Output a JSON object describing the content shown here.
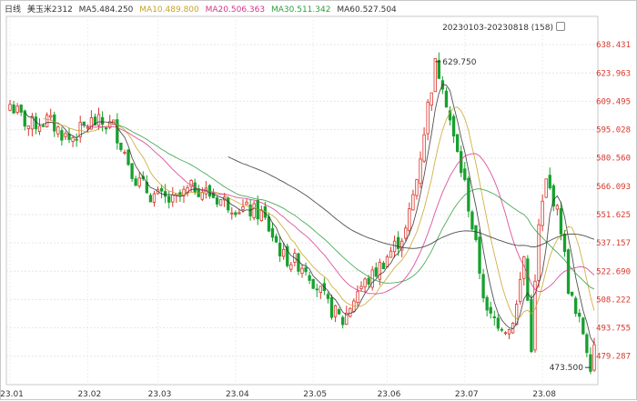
{
  "header": {
    "period": "日线",
    "symbol": "美玉米2312",
    "ma": [
      {
        "label": "MA5.",
        "value": "484.250",
        "color": "#333333"
      },
      {
        "label": "MA10.",
        "value": "489.800",
        "color": "#c9a227"
      },
      {
        "label": "MA20.",
        "value": "506.363",
        "color": "#d6338a"
      },
      {
        "label": "MA30.",
        "value": "511.342",
        "color": "#2e9e3e"
      },
      {
        "label": "MA60.",
        "value": "527.504",
        "color": "#333333"
      }
    ],
    "range": "20230103-20230818 (158)"
  },
  "colors": {
    "up": "#d9362b",
    "down": "#18a02e",
    "grid": "#c8c8c8",
    "axis_text": "#d9362b"
  },
  "icons": {
    "range": "settings-icon"
  },
  "chart_data": {
    "type": "candlestick",
    "title": "美玉米2312",
    "grid": true,
    "ylim": [
      464.74,
      652.9
    ],
    "y_ticks": [
      "638.431",
      "623.963",
      "609.495",
      "595.028",
      "580.560",
      "566.093",
      "551.625",
      "537.157",
      "522.690",
      "508.222",
      "493.755",
      "479.287"
    ],
    "x_ticks": [
      "23.01",
      "23.02",
      "23.03",
      "23.04",
      "23.05",
      "23.06",
      "23.07",
      "23.08"
    ],
    "annotations": {
      "high": "629.750",
      "low": "473.500"
    },
    "anchors": [
      {
        "d": 0,
        "p": 608
      },
      {
        "d": 5,
        "p": 597
      },
      {
        "d": 10,
        "p": 600
      },
      {
        "d": 16,
        "p": 590
      },
      {
        "d": 22,
        "p": 599
      },
      {
        "d": 28,
        "p": 597
      },
      {
        "d": 34,
        "p": 570
      },
      {
        "d": 38,
        "p": 562
      },
      {
        "d": 44,
        "p": 558
      },
      {
        "d": 50,
        "p": 566
      },
      {
        "d": 56,
        "p": 560
      },
      {
        "d": 62,
        "p": 555
      },
      {
        "d": 68,
        "p": 552
      },
      {
        "d": 74,
        "p": 530
      },
      {
        "d": 80,
        "p": 525
      },
      {
        "d": 86,
        "p": 505
      },
      {
        "d": 90,
        "p": 497
      },
      {
        "d": 94,
        "p": 513
      },
      {
        "d": 98,
        "p": 520
      },
      {
        "d": 103,
        "p": 533
      },
      {
        "d": 107,
        "p": 543
      },
      {
        "d": 110,
        "p": 570
      },
      {
        "d": 113,
        "p": 607
      },
      {
        "d": 115,
        "p": 628
      },
      {
        "d": 117,
        "p": 620
      },
      {
        "d": 120,
        "p": 590
      },
      {
        "d": 123,
        "p": 567
      },
      {
        "d": 126,
        "p": 535
      },
      {
        "d": 129,
        "p": 500
      },
      {
        "d": 132,
        "p": 497
      },
      {
        "d": 135,
        "p": 493
      },
      {
        "d": 137,
        "p": 505
      },
      {
        "d": 139,
        "p": 530
      },
      {
        "d": 141,
        "p": 485
      },
      {
        "d": 143,
        "p": 545
      },
      {
        "d": 145,
        "p": 568
      },
      {
        "d": 147,
        "p": 560
      },
      {
        "d": 149,
        "p": 545
      },
      {
        "d": 151,
        "p": 515
      },
      {
        "d": 153,
        "p": 500
      },
      {
        "d": 155,
        "p": 492
      },
      {
        "d": 157,
        "p": 476
      },
      {
        "d": 158,
        "p": 486
      }
    ],
    "ma_overlays": [
      {
        "name": "MA5",
        "period": 5,
        "color": "#333333"
      },
      {
        "name": "MA10",
        "period": 10,
        "color": "#c9a227"
      },
      {
        "name": "MA20",
        "period": 20,
        "color": "#d6338a"
      },
      {
        "name": "MA30",
        "period": 30,
        "color": "#2e9e3e"
      },
      {
        "name": "MA60",
        "period": 60,
        "color": "#333333"
      }
    ]
  }
}
